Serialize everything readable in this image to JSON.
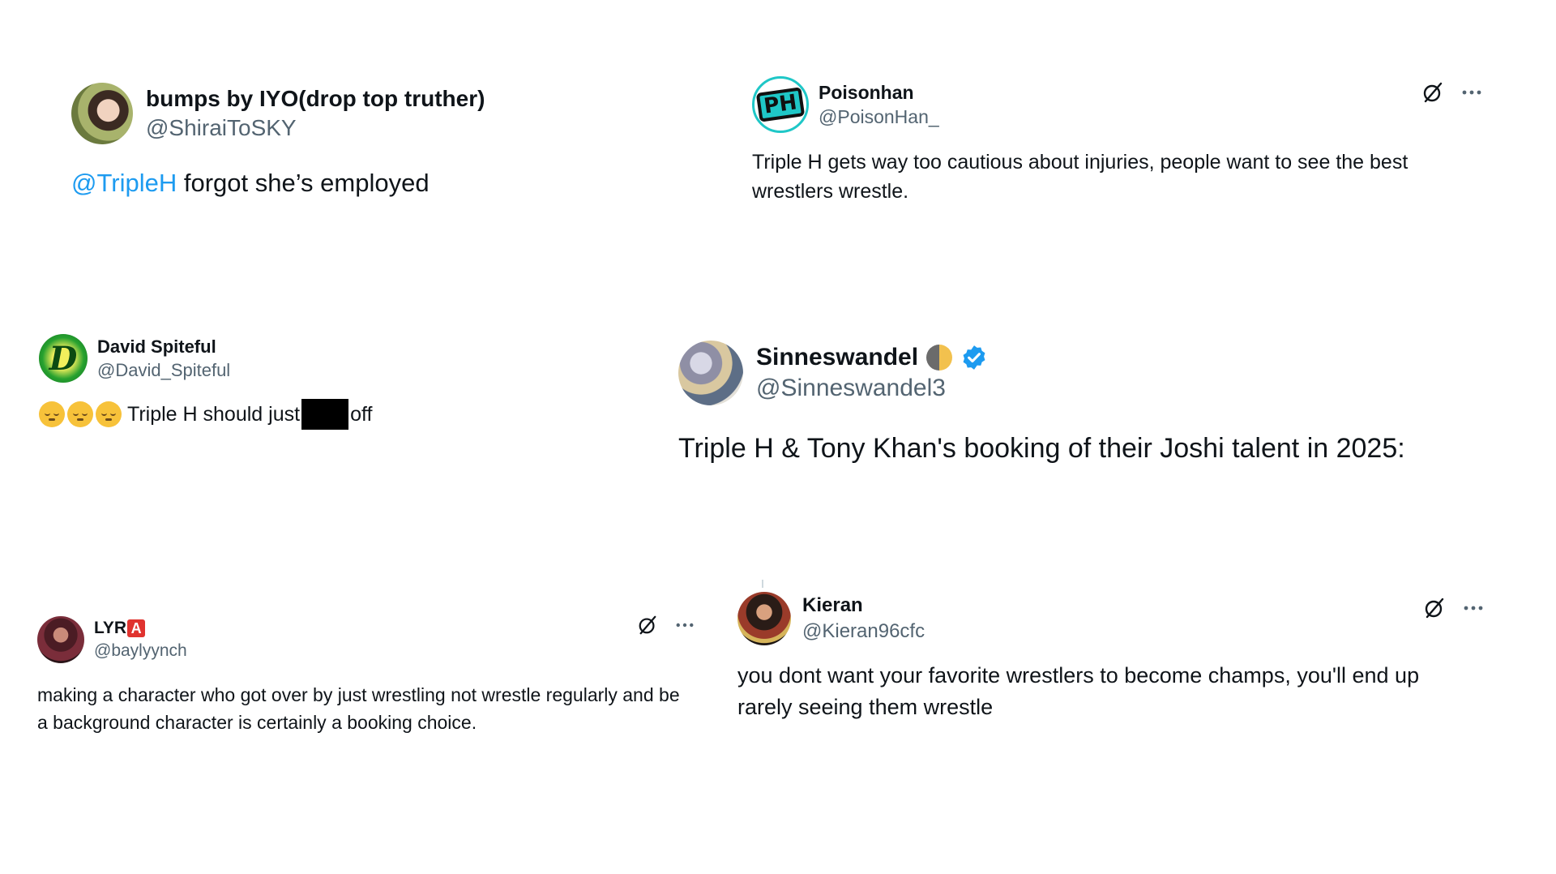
{
  "tweets": [
    {
      "display_name": "bumps by IYO(drop top truther)",
      "handle": "@ShiraiToSKY",
      "mention": "@TripleH",
      "text": " forgot she’s employed"
    },
    {
      "display_name": "Poisonhan",
      "handle": "@PoisonHan_",
      "avatar_text": "PH",
      "text": "Triple H gets way too cautious about injuries, people want to see the best wrestlers wrestle.",
      "icons": [
        "grok-icon",
        "more-icon"
      ]
    },
    {
      "display_name": "David Spiteful",
      "handle": "@David_Spiteful",
      "avatar_text": "D",
      "emojis": [
        "pensive-face",
        "pensive-face",
        "pensive-face"
      ],
      "text_before": "Triple H should just",
      "text_after": "off"
    },
    {
      "display_name": "Sinneswandel",
      "handle": "@Sinneswandel3",
      "verified": true,
      "text": "Triple H & Tony Khan's booking of their Joshi talent in 2025:"
    },
    {
      "display_name_prefix": "LYR",
      "display_name_suffix": "A",
      "handle": "@baylyynch",
      "text": "making a character who got over by just wrestling not wrestle regularly and be a background character is certainly a booking choice.",
      "icons": [
        "grok-icon",
        "more-icon"
      ]
    },
    {
      "display_name": "Kieran",
      "handle": "@Kieran96cfc",
      "text": "you dont want your favorite wrestlers to become champs, you'll end up rarely seeing them wrestle",
      "icons": [
        "grok-icon",
        "more-icon"
      ]
    }
  ],
  "colors": {
    "mention": "#1d9bf0",
    "handle": "#536471",
    "text": "#0f1419",
    "verified": "#1d9bf0",
    "lyra_badge": "#e0332f"
  }
}
